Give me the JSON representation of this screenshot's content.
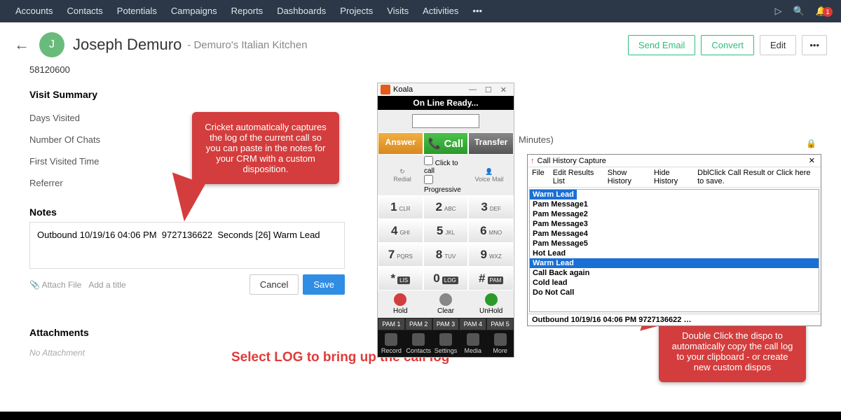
{
  "nav": {
    "items": [
      "Accounts",
      "Contacts",
      "Potentials",
      "Campaigns",
      "Reports",
      "Dashboards",
      "Projects",
      "Visits",
      "Activities"
    ],
    "more": "•••",
    "notif_count": "1"
  },
  "header": {
    "back": "←",
    "avatar_initial": "J",
    "name": "Joseph Demuro",
    "company": "- Demuro's Italian Kitchen",
    "send_email": "Send Email",
    "convert": "Convert",
    "edit": "Edit",
    "more": "•••"
  },
  "left": {
    "number": "58120600",
    "section_visit": "Visit Summary",
    "days_visited": "Days Visited",
    "num_chats": "Number Of Chats",
    "first_visited": "First Visited Time",
    "referrer": "Referrer",
    "time_label": "Minutes)",
    "notes_head": "Notes",
    "notes_value": "Outbound 10/19/16 04:06 PM  9727136622  Seconds [26] Warm Lead",
    "attach_file": "📎 Attach File",
    "add_title": "Add a title",
    "cancel": "Cancel",
    "save": "Save",
    "attachments_head": "Attachments",
    "no_attachment": "No Attachment"
  },
  "callouts": {
    "c1": "Cricket automatically captures the log of the current call so you can paste in the notes for your CRM with a custom disposition.",
    "a1": "Select LOG to bring up the call log",
    "c2": "Double Click the dispo to automatically copy the call log to your clipboard - or create new custom dispos"
  },
  "dialer": {
    "title": "Koala",
    "status": "On Line Ready...",
    "answer": "Answer",
    "call": "📞 Call",
    "transfer": "Transfer",
    "redial": "Redial",
    "click_to_call": "Click to call",
    "progressive": "Progressive",
    "voice_mail": "Voice Mail",
    "keys": [
      {
        "n": "1",
        "sub": "CLR"
      },
      {
        "n": "2",
        "sub": "ABC"
      },
      {
        "n": "3",
        "sub": "DEF"
      },
      {
        "n": "4",
        "sub": "GHI"
      },
      {
        "n": "5",
        "sub": "JKL"
      },
      {
        "n": "6",
        "sub": "MNO"
      },
      {
        "n": "7",
        "sub": "PQRS"
      },
      {
        "n": "8",
        "sub": "TUV"
      },
      {
        "n": "9",
        "sub": "WXZ"
      },
      {
        "n": "*",
        "tag": "LIS"
      },
      {
        "n": "0",
        "tag": "LOG"
      },
      {
        "n": "#",
        "tag": "PAM"
      }
    ],
    "hold": "Hold",
    "clear": "Clear",
    "unhold": "UnHold",
    "pam": [
      "PAM 1",
      "PAM 2",
      "PAM 3",
      "PAM 4",
      "PAM 5"
    ],
    "bottom": [
      "Record",
      "Contacts",
      "Settings",
      "Media",
      "More"
    ]
  },
  "history": {
    "title": "Call History Capture",
    "menu": [
      "File",
      "Edit Results List",
      "Show History",
      "Hide History",
      "DblClick Call Result or Click here to save."
    ],
    "first_sel": "Warm Lead",
    "items": [
      "Pam Message1",
      "Pam Message2",
      "Pam Message3",
      "Pam Message4",
      "Pam Message5",
      "Hot Lead",
      "Warm Lead",
      "Call Back again",
      "Cold lead",
      "Do Not Call"
    ],
    "selected_index": 6,
    "status": "Outbound 10/19/16 04:06 PM  9727136622  …"
  }
}
